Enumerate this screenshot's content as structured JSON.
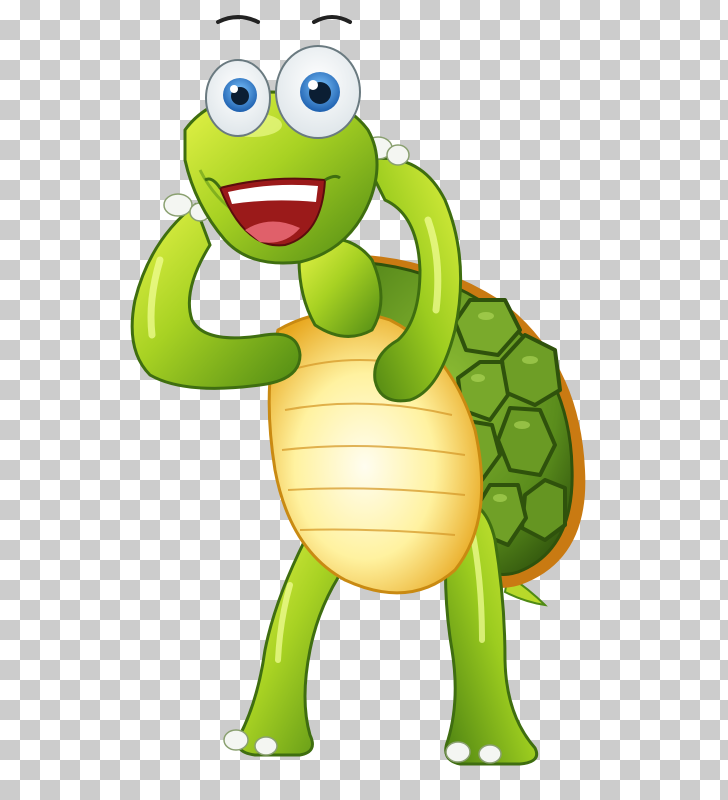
{
  "image": {
    "subject": "turtle",
    "background_pattern": "transparency-checkerboard",
    "colors": {
      "checker_light": "#ffffff",
      "checker_dark": "#cccccc",
      "skin_light": "#d9ee3a",
      "skin_mid": "#9ccc1f",
      "skin_dark": "#4f8a14",
      "shell_light": "#76a62a",
      "shell_dark": "#3f6a12",
      "shell_rim": "#c97a12",
      "belly_light": "#fffbe0",
      "belly_dark": "#f2c233",
      "mouth": "#9b1a1a",
      "tongue": "#e0606a",
      "iris": "#2e7fd0"
    }
  }
}
